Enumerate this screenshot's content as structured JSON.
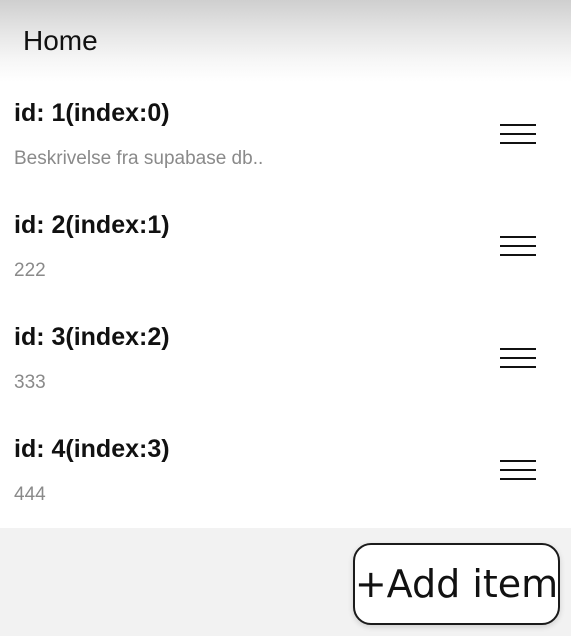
{
  "header": {
    "title": "Home"
  },
  "list": {
    "items": [
      {
        "title": "id: 1(index:0)",
        "description": "Beskrivelse fra supabase db.."
      },
      {
        "title": "id: 2(index:1)",
        "description": "222"
      },
      {
        "title": "id: 3(index:2)",
        "description": "333"
      },
      {
        "title": "id: 4(index:3)",
        "description": "444"
      }
    ],
    "handle_icon": "drag-handle-icon"
  },
  "actions": {
    "add_item_label": "+Add item"
  }
}
